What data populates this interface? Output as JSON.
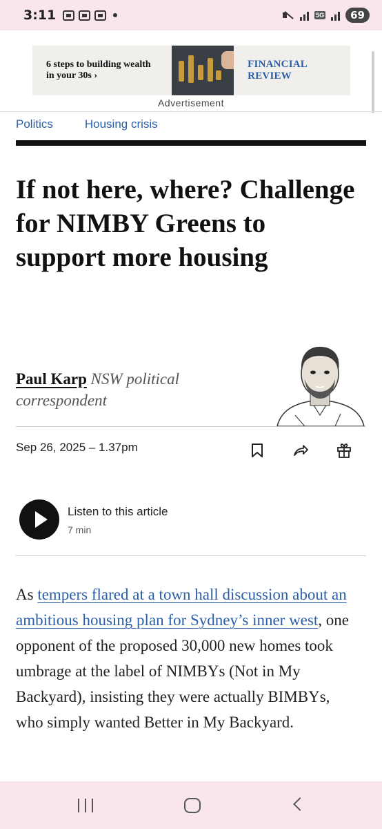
{
  "status_bar": {
    "time": "3:11",
    "battery": "69",
    "network": "5G"
  },
  "ad": {
    "text_line1": "6 steps to building wealth",
    "text_line2": "in your 30s ›",
    "brand": "FINANCIAL REVIEW",
    "label": "Advertisement"
  },
  "nav": {
    "topics": [
      "Politics",
      "Housing crisis"
    ]
  },
  "article": {
    "headline": "If not here, where? Challenge for NIMBY Greens to support more housing",
    "author_name": "Paul Karp",
    "author_role": "NSW political correspondent",
    "date": "Sep 26, 2025 – 1.37pm",
    "audio": {
      "label": "Listen to this article",
      "duration": "7 min"
    },
    "body": {
      "lead": "As ",
      "link_text": "tempers flared at a town hall discussion about an ambitious housing plan for Sydney’s inner west",
      "rest": ", one opponent of the proposed 30,000 new homes took umbrage at the label of NIMBYs (Not in My Backyard), insisting they were actually BIMBYs, who simply wanted Better in My Backyard."
    }
  },
  "icons": {
    "actions": [
      "bookmark-icon",
      "share-icon",
      "gift-icon"
    ],
    "system_nav": [
      "recents-icon",
      "home-icon",
      "back-icon"
    ]
  }
}
